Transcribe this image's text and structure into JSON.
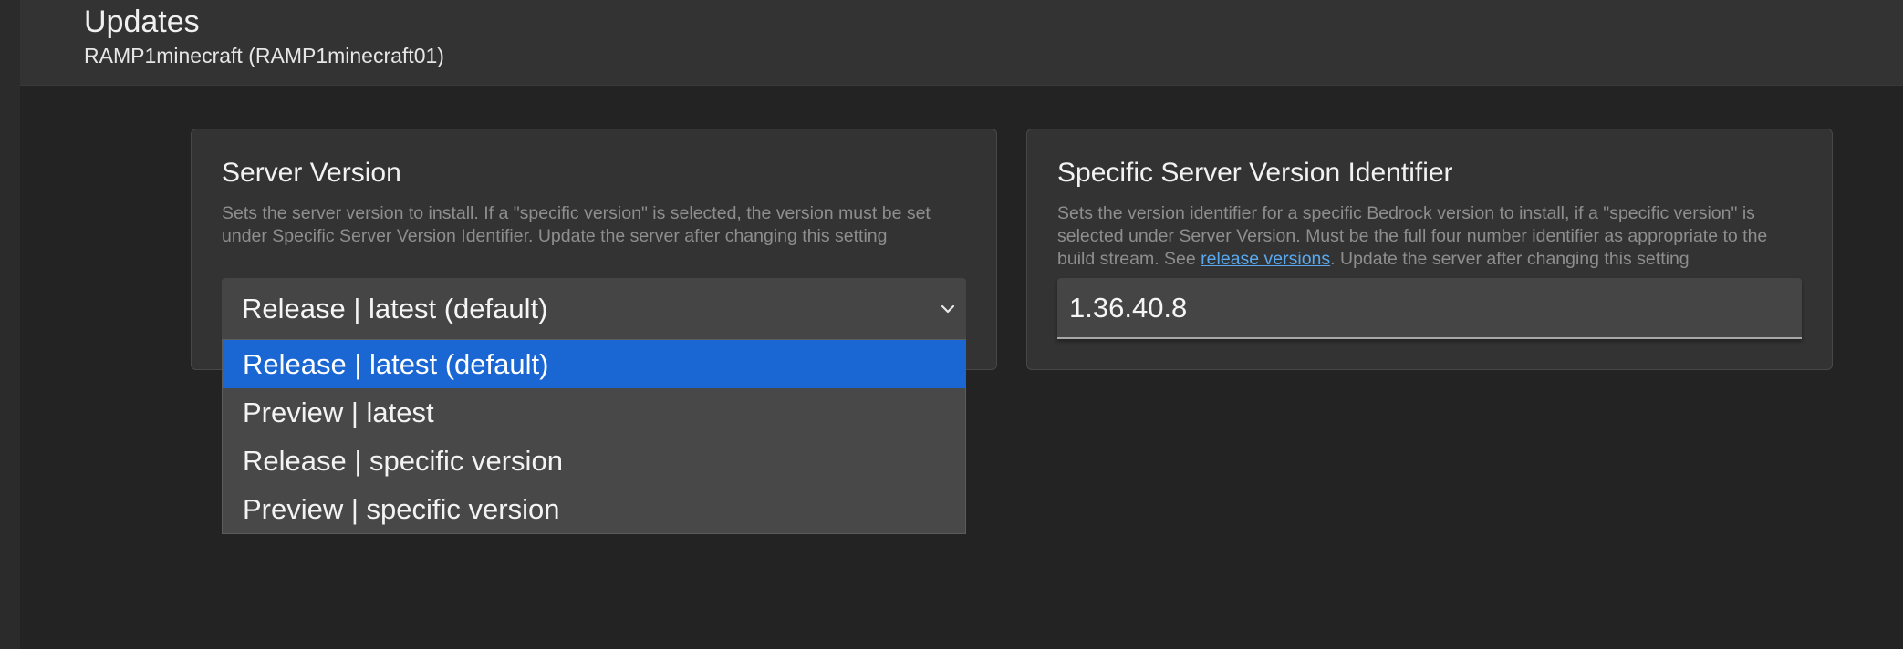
{
  "header": {
    "title": "Updates",
    "subtitle": "RAMP1minecraft (RAMP1minecraft01)"
  },
  "server_version": {
    "title": "Server Version",
    "description": "Sets the server version to install. If a \"specific version\" is selected, the version must be set under Specific Server Version Identifier. Update the server after changing this setting",
    "selected_value": "Release | latest (default)",
    "options": [
      {
        "label": "Release | latest (default)",
        "selected": true
      },
      {
        "label": "Preview | latest",
        "selected": false
      },
      {
        "label": "Release | specific version",
        "selected": false
      },
      {
        "label": "Preview | specific version",
        "selected": false
      }
    ]
  },
  "specific_version": {
    "title": "Specific Server Version Identifier",
    "description_before_link": "Sets the version identifier for a specific Bedrock version to install, if a \"specific version\" is selected under Server Version. Must be the full four number identifier as appropriate to the build stream. See ",
    "link_text": "release versions",
    "description_after_link": ". Update the server after changing this setting",
    "value": "1.36.40.8"
  },
  "icons": {
    "dropdown_arrow": "chevron-down-icon"
  },
  "colors": {
    "selected_option": "#1a66d2",
    "link": "#5aa9f0"
  }
}
